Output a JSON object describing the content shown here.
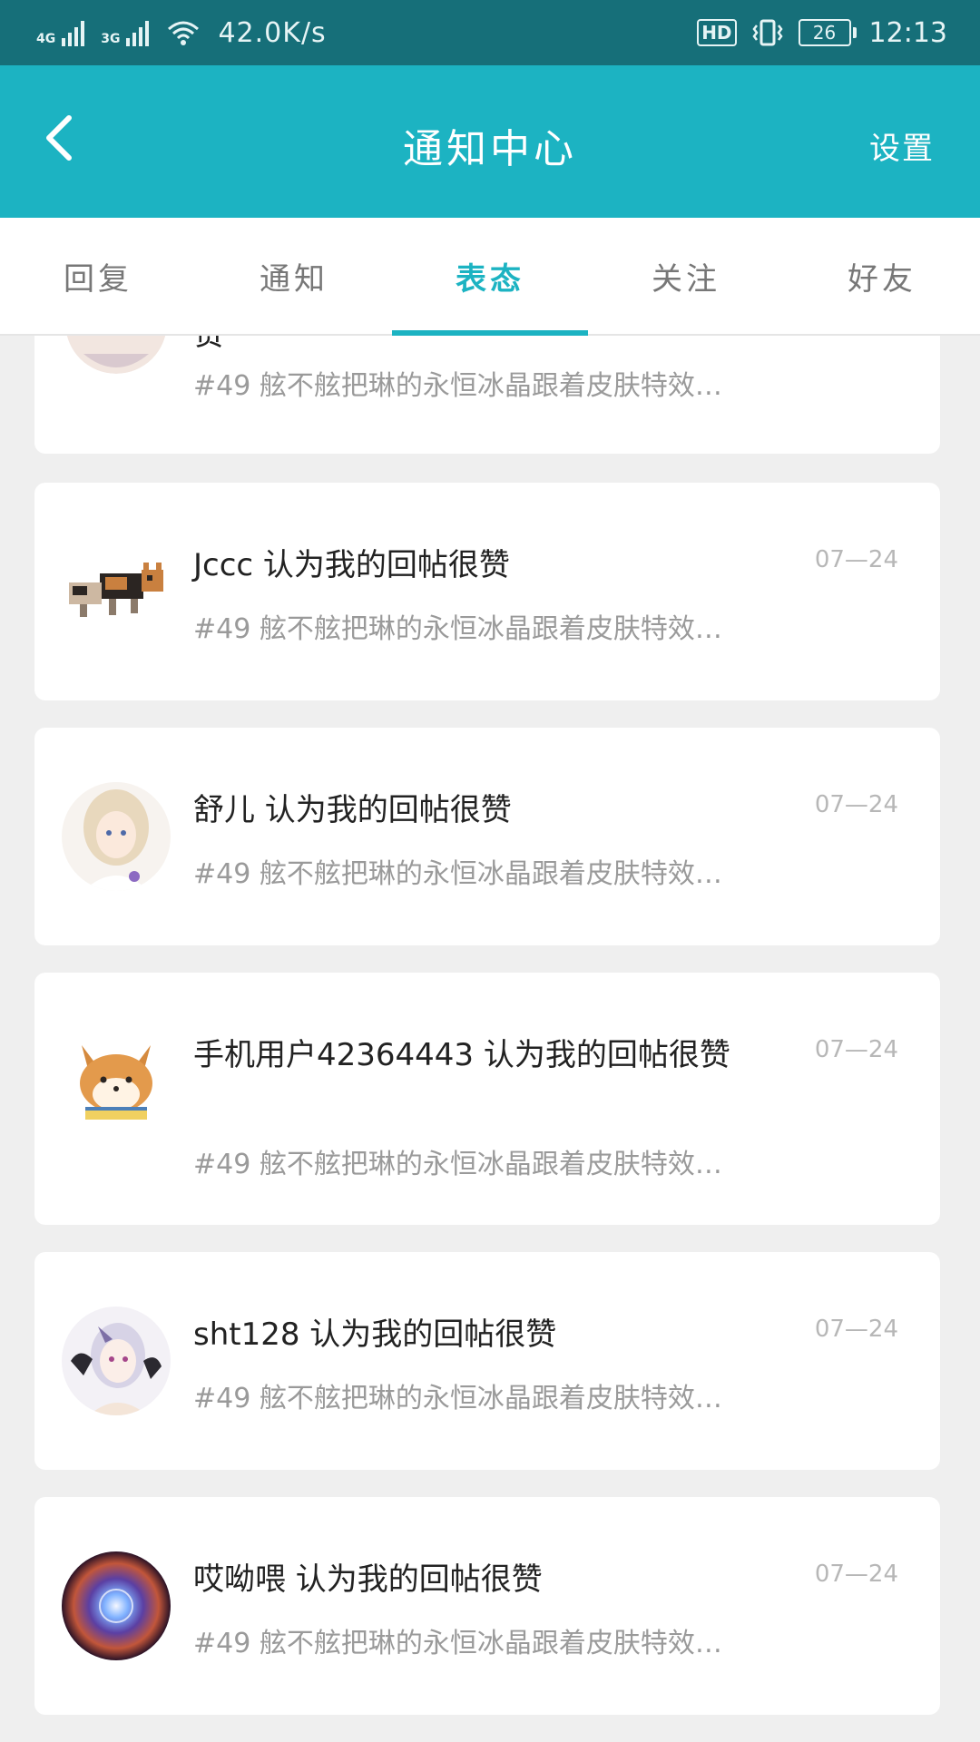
{
  "status_bar": {
    "network1": "4G",
    "network2": "3G",
    "speed": "42.0K/s",
    "hd": "HD",
    "battery": "26",
    "time": "12:13"
  },
  "header": {
    "title": "通知中心",
    "settings_label": "设置",
    "back_icon": "chevron-left-icon"
  },
  "tabs": [
    {
      "label": "回复",
      "active": false
    },
    {
      "label": "通知",
      "active": false
    },
    {
      "label": "表态",
      "active": true
    },
    {
      "label": "关注",
      "active": false
    },
    {
      "label": "好友",
      "active": false
    }
  ],
  "colors": {
    "status_bar": "#166f79",
    "header": "#1cb3c2",
    "accent": "#1cb3c2",
    "background": "#efefef"
  },
  "notifications": [
    {
      "title": "赞",
      "date": "",
      "excerpt": "#49  舷不舷把琳的永恒冰晶跟着皮肤特效…",
      "avatar": "anime-character-avatar"
    },
    {
      "title": "Jccc  认为我的回帖很赞",
      "date": "07—24",
      "excerpt": "#49  舷不舷把琳的永恒冰晶跟着皮肤特效…",
      "avatar": "pixel-dog-avatar"
    },
    {
      "title": "舒儿  认为我的回帖很赞",
      "date": "07—24",
      "excerpt": "#49  舷不舷把琳的永恒冰晶跟着皮肤特效…",
      "avatar": "anime-girl-avatar"
    },
    {
      "title": "手机用户42364443  认为我的回帖很赞",
      "date": "07—24",
      "excerpt": "#49  舷不舷把琳的永恒冰晶跟着皮肤特效…",
      "avatar": "shiba-dog-avatar"
    },
    {
      "title": "sht128  认为我的回帖很赞",
      "date": "07—24",
      "excerpt": "#49  舷不舷把琳的永恒冰晶跟着皮肤特效…",
      "avatar": "anime-girl-avatar"
    },
    {
      "title": "哎呦喂  认为我的回帖很赞",
      "date": "07—24",
      "excerpt": "#49  舷不舷把琳的永恒冰晶跟着皮肤特效…",
      "avatar": "nebula-avatar"
    }
  ]
}
